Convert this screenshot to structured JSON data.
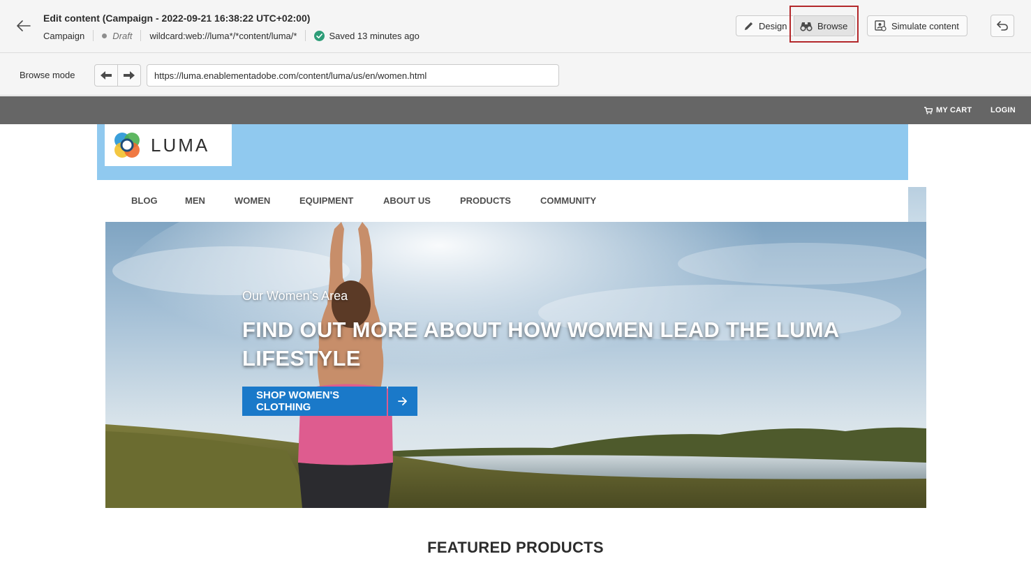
{
  "editor": {
    "title": "Edit content (Campaign - 2022-09-21 16:38:22 UTC+02:00)",
    "type_label": "Campaign",
    "status": "Draft",
    "url_pattern": "wildcard:web://luma*/*content/luma/*",
    "saved_text": "Saved 13 minutes ago",
    "buttons": {
      "design": "Design",
      "browse": "Browse",
      "simulate": "Simulate content"
    }
  },
  "browse_bar": {
    "label": "Browse mode",
    "url": "https://luma.enablementadobe.com/content/luma/us/en/women.html"
  },
  "site": {
    "topbar": {
      "cart": "MY CART",
      "login": "LOGIN"
    },
    "logo_text": "LUMA",
    "nav": [
      "BLOG",
      "MEN",
      "WOMEN",
      "EQUIPMENT",
      "ABOUT US",
      "PRODUCTS",
      "COMMUNITY"
    ],
    "hero": {
      "subtitle": "Our Women's Area",
      "title": "FIND OUT MORE ABOUT HOW WOMEN LEAD THE LUMA LIFESTYLE",
      "cta": "SHOP WOMEN'S CLOTHING"
    },
    "featured_heading": "FEATURED PRODUCTS"
  },
  "colors": {
    "highlight": "#b3282b",
    "cta": "#1a79c9",
    "banner": "#90c9ef",
    "topbar": "#666666",
    "saved": "#2d9d78"
  }
}
